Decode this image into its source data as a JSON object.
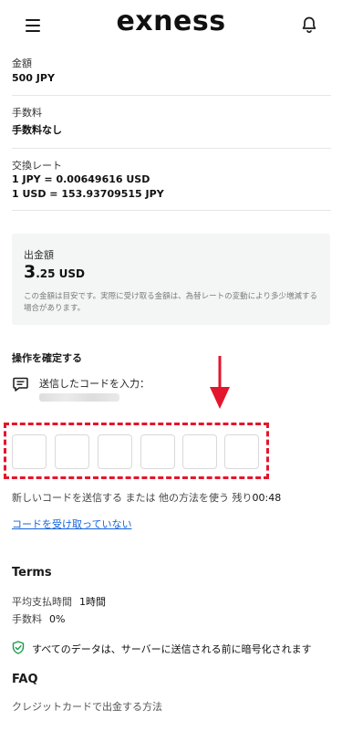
{
  "header": {
    "logo": "exness",
    "menu_icon": "hamburger-menu-icon",
    "bell_icon": "bell-icon"
  },
  "details": {
    "amount_label": "金額",
    "amount_value": "500 JPY",
    "fee_label": "手数料",
    "fee_value": "手数料なし",
    "rate_label": "交換レート",
    "rate_line1": "1 JPY = 0.00649616 USD",
    "rate_line2": "1 USD = 153.93709515 JPY"
  },
  "summary": {
    "label": "出金額",
    "amount_int": "3",
    "amount_rest": ".25 USD",
    "note": "この金額は目安です。実際に受け取る金額は、為替レートの変動により多少増減する場合があります。"
  },
  "confirm": {
    "title": "操作を確定する",
    "sent_label": "送信したコードを入力：",
    "otp_digits": [
      "",
      "",
      "",
      "",
      "",
      ""
    ],
    "resend_text": "新しいコードを送信する または 他の方法を使う 残り",
    "timer": "00:48",
    "not_received": "コードを受け取っていない"
  },
  "terms": {
    "title": "Terms",
    "rows": [
      {
        "label": "平均支払時間",
        "value": "1時間"
      },
      {
        "label": "手数料",
        "value": "0%"
      }
    ],
    "encryption": "すべてのデータは、サーバーに送信される前に暗号化されます"
  },
  "faq": {
    "title": "FAQ",
    "items": [
      "クレジットカードで出金する方法"
    ]
  },
  "colors": {
    "accent_link": "#1463d8",
    "annotation_red": "#e4162b",
    "shield_green": "#1a9a4a"
  }
}
